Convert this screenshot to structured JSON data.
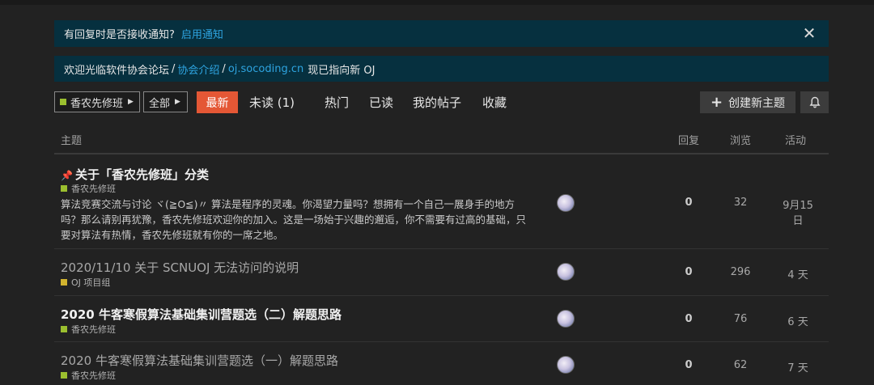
{
  "banners": {
    "notify_text": "有回复时是否接收通知?",
    "notify_link": "启用通知",
    "welcome_text": "欢迎光临软件协会论坛",
    "sep1": "/",
    "intro_link": "协会介绍",
    "sep2": "/",
    "oj_link": "oj.socoding.cn",
    "oj_suffix": "现已指向新 OJ"
  },
  "filters": {
    "category": "香农先修班",
    "tag": "全部"
  },
  "nav": {
    "latest": "最新",
    "unread": "未读 (1)",
    "hot": "热门",
    "read": "已读",
    "mine": "我的帖子",
    "fav": "收藏",
    "create": "创建新主题"
  },
  "table": {
    "headers": {
      "topic": "主题",
      "replies": "回复",
      "views": "浏览",
      "activity": "活动"
    },
    "rows": [
      {
        "title": "关于「香农先修班」分类",
        "category": "香农先修班",
        "excerpt": "算法竞赛交流与讨论 ヾ(≧O≦)〃 算法是程序的灵魂。你渴望力量吗？想拥有一个自己一展身手的地方吗？那么请别再犹豫，香农先修班欢迎你的加入。这是一场始于兴趣的邂逅，你不需要有过高的基础，只要对算法有热情，香农先修班就有你的一席之地。",
        "replies": "0",
        "views": "32",
        "activity": "9月15日"
      },
      {
        "title": "2020/11/10 关于 SCNUOJ 无法访问的说明",
        "category": "OJ 项目组",
        "replies": "0",
        "views": "296",
        "activity": "4 天"
      },
      {
        "title": "2020 牛客寒假算法基础集训营题选（二）解题思路",
        "category": "香农先修班",
        "replies": "0",
        "views": "76",
        "activity": "6 天"
      },
      {
        "title": "2020 牛客寒假算法基础集训营题选（一）解题思路",
        "category": "香农先修班",
        "replies": "0",
        "views": "62",
        "activity": "7 天"
      }
    ]
  },
  "colors": {
    "accent": "#e45735",
    "banner_bg": "#06303f",
    "link": "#2ea4e0",
    "category_green": "#9bbf2f",
    "category_gold": "#d2b32e"
  }
}
